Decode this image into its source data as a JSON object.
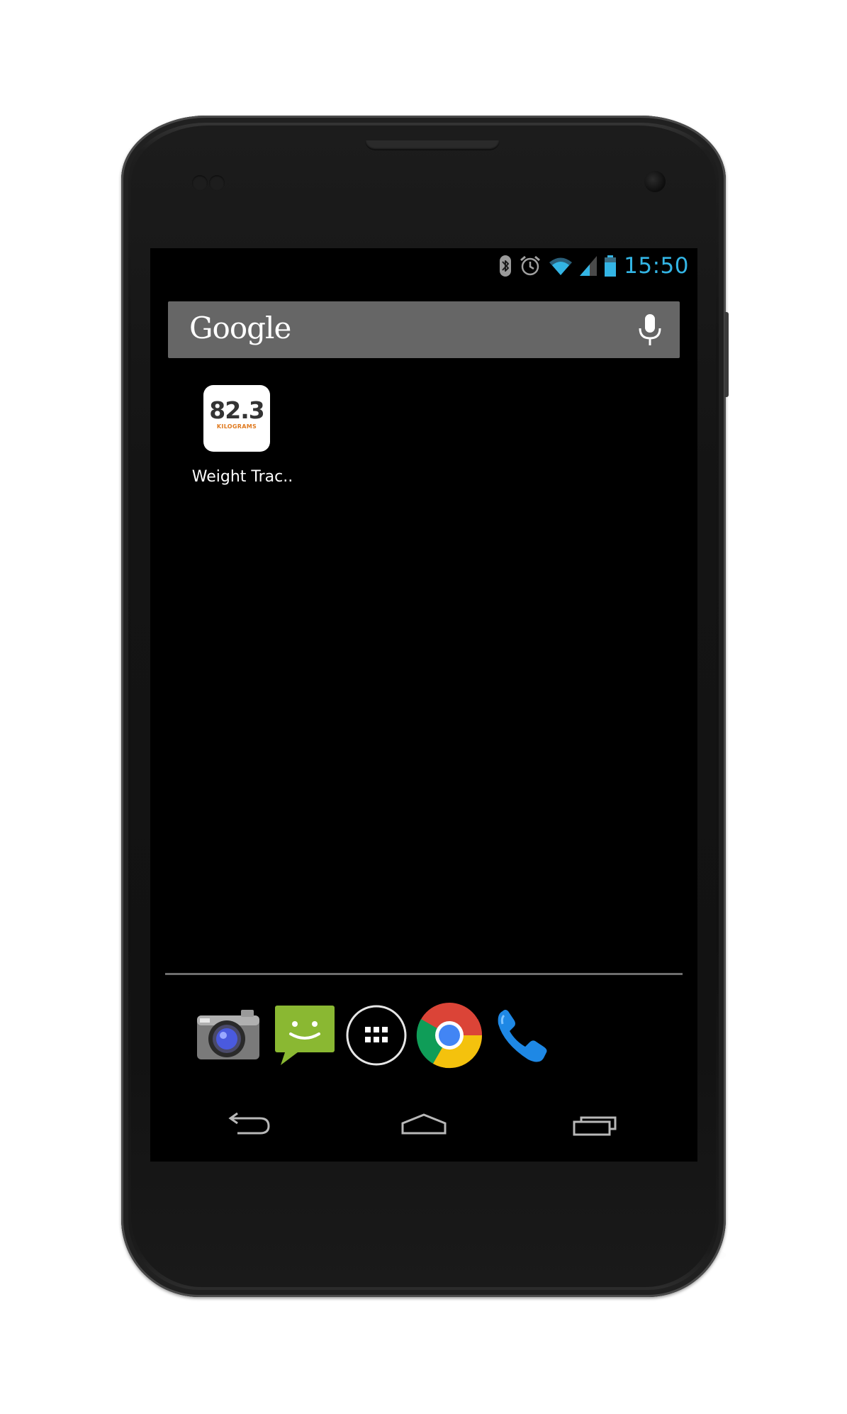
{
  "status_bar": {
    "time": "15:50",
    "clock_color": "#33b5e5",
    "icons": [
      "bluetooth-icon",
      "alarm-icon",
      "wifi-icon",
      "signal-icon",
      "battery-icon"
    ]
  },
  "search_widget": {
    "logo_text": "Google",
    "voice_icon": "microphone-icon"
  },
  "home_shortcuts": [
    {
      "label": "Weight Trac..",
      "icon_value": "82.3",
      "icon_unit": "KILOGRAMS"
    }
  ],
  "dock": {
    "items": [
      "camera-icon",
      "messaging-icon",
      "app-drawer-icon",
      "chrome-icon",
      "phone-icon"
    ]
  },
  "nav_bar": {
    "buttons": [
      "back-icon",
      "home-icon",
      "recent-apps-icon"
    ]
  }
}
